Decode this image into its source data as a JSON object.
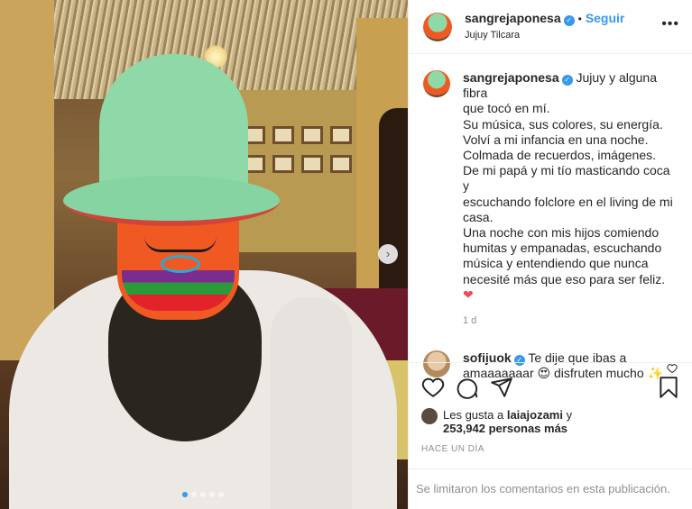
{
  "post": {
    "username": "sangrejaponesa",
    "follow_label": "Seguir",
    "separator": "•",
    "location": "Jujuy Tilcara",
    "more_label": "•••"
  },
  "caption": {
    "username": "sangrejaponesa",
    "lines": [
      "Jujuy y alguna fibra",
      "que tocó en mí.",
      "Su música, sus colores, su energía.",
      "Volví a mi infancia en una noche.",
      "Colmada de recuerdos, imágenes.",
      "De mi papá y mi tío masticando coca y",
      "escuchando folclore en el living de mi",
      "casa.",
      "Una noche con mis hijos comiendo",
      "humitas y empanadas, escuchando",
      "música y entendiendo que nunca",
      "necesité más que eso para ser feliz."
    ],
    "heart": "❤",
    "time_ago": "1 d"
  },
  "comment": {
    "username": "sofijuok",
    "text_part1": "Te dije que ibas a",
    "text_part2": "amaaaaaaar",
    "emoji1": "😍",
    "text_part3": "disfruten mucho",
    "emoji2": "✨"
  },
  "likes": {
    "prefix": "Les gusta a",
    "user": "laiajozami",
    "connector": "y",
    "count_text": "253,942 personas más"
  },
  "timestamp": "HACE UN DÍA",
  "footer_text": "Se limitaron los comentarios en esta publicación.",
  "carousel": {
    "arrow": "›",
    "dot_count": 5,
    "active_dot": 0
  },
  "icons": [
    "heart-outline-icon",
    "comment-icon",
    "share-icon",
    "bookmark-icon"
  ],
  "colors": {
    "accent": "#3897f0",
    "heart": "#ed4956",
    "muted": "#8e8e8e"
  }
}
